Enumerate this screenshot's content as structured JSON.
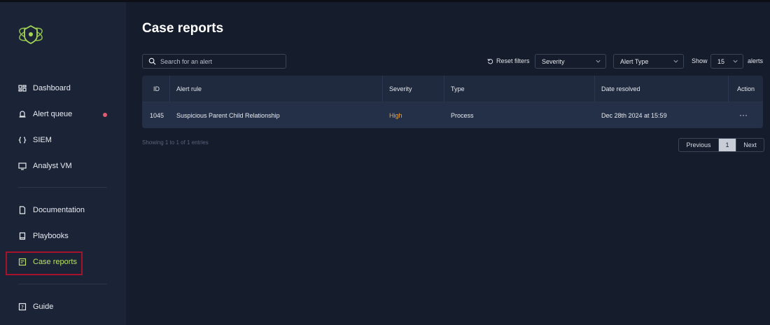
{
  "colors": {
    "accent": "#b8e06a",
    "alert_dot": "#e25c6f",
    "severity_high": "#f0a53d",
    "highlight_box": "#a3132b"
  },
  "sidebar": {
    "items": [
      {
        "label": "Dashboard",
        "icon": "dashboard-icon"
      },
      {
        "label": "Alert queue",
        "icon": "alert-queue-icon",
        "notification": true
      },
      {
        "label": "SIEM",
        "icon": "siem-icon"
      },
      {
        "label": "Analyst VM",
        "icon": "monitor-icon"
      },
      {
        "label": "Documentation",
        "icon": "document-icon"
      },
      {
        "label": "Playbooks",
        "icon": "book-icon"
      },
      {
        "label": "Case reports",
        "icon": "report-icon",
        "active": true
      },
      {
        "label": "Guide",
        "icon": "help-icon"
      }
    ]
  },
  "page": {
    "title": "Case reports"
  },
  "toolbar": {
    "search_placeholder": "Search for an alert",
    "reset_label": "Reset filters",
    "severity_select": "Severity",
    "alert_type_select": "Alert Type",
    "show_label": "Show",
    "show_count": "15",
    "alerts_label": "alerts"
  },
  "table": {
    "headers": [
      "ID",
      "Alert rule",
      "Severity",
      "Type",
      "Date resolved",
      "Action"
    ],
    "rows": [
      {
        "id": "1045",
        "rule": "Suspicious Parent Child Relationship",
        "severity": "High",
        "type": "Process",
        "date": "Dec 28th 2024 at 15:59",
        "action": "···"
      }
    ]
  },
  "footer": {
    "entries": "Showing 1 to 1 of 1 entries",
    "prev": "Previous",
    "page": "1",
    "next": "Next"
  }
}
